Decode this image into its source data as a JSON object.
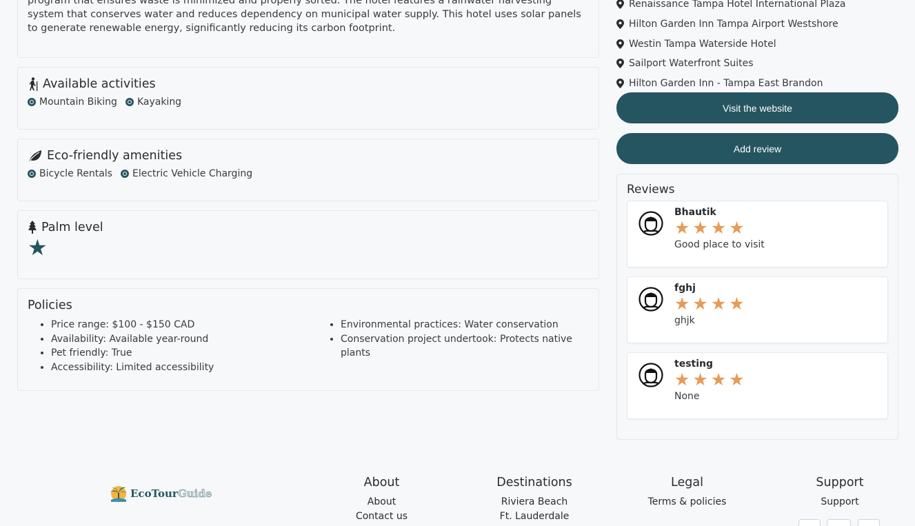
{
  "description": {
    "text": "program that ensures waste is minimized and properly sorted. The hotel features a rainwater harvesting system that conserves water and reduces dependency on municipal water supply. This hotel uses solar panels to generate renewable energy, significantly reducing its carbon footprint."
  },
  "activities": {
    "title": "Available activities",
    "icon": "hiking-icon",
    "items": [
      "Mountain Biking",
      "Kayaking"
    ]
  },
  "amenities": {
    "title": "Eco-friendly amenities",
    "icon": "leaf-icon",
    "items": [
      "Bicycle Rentals",
      "Electric Vehicle Charging"
    ]
  },
  "palm": {
    "title": "Palm level",
    "icon": "tree-icon",
    "stars": 1
  },
  "policies": {
    "title": "Policies",
    "left": [
      "Price range: $100 - $150 CAD",
      "Availability: Available year-round",
      "Pet friendly: True",
      "Accessibility: Limited accessibility"
    ],
    "right": [
      "Environmental practices: Water conservation",
      "Conservation project undertook: Protects native plants"
    ]
  },
  "nearby_hotels": [
    "Renaissance Tampa Hotel International Plaza",
    "Hilton Garden Inn Tampa Airport Westshore",
    "Westin Tampa Waterside Hotel",
    "Sailport Waterfront Suites",
    "Hilton Garden Inn - Tampa East Brandon"
  ],
  "buttons": {
    "visit": "Visit the website",
    "review": "Add review"
  },
  "reviews": {
    "title": "Reviews",
    "star_color": "#e89a56",
    "items": [
      {
        "name": "Bhautik",
        "rating": 4,
        "text": "Good place to visit"
      },
      {
        "name": "fghj",
        "rating": 4,
        "text": "ghjk"
      },
      {
        "name": "testing",
        "rating": 4,
        "text": "None"
      }
    ]
  },
  "footer": {
    "logo": {
      "text_main": "EcoTour",
      "text_accent": "Guide"
    },
    "about": {
      "title": "About",
      "links": [
        "About",
        "Contact us"
      ]
    },
    "destinations": {
      "title": "Destinations",
      "links": [
        "Riviera Beach",
        "Ft. Lauderdale"
      ]
    },
    "legal": {
      "title": "Legal",
      "links": [
        "Terms & policies"
      ]
    },
    "support": {
      "title": "Support",
      "links": [
        "Support"
      ]
    }
  },
  "colors": {
    "primary": "#255560",
    "star": "#e89a56",
    "background": "#f7f8fa"
  }
}
